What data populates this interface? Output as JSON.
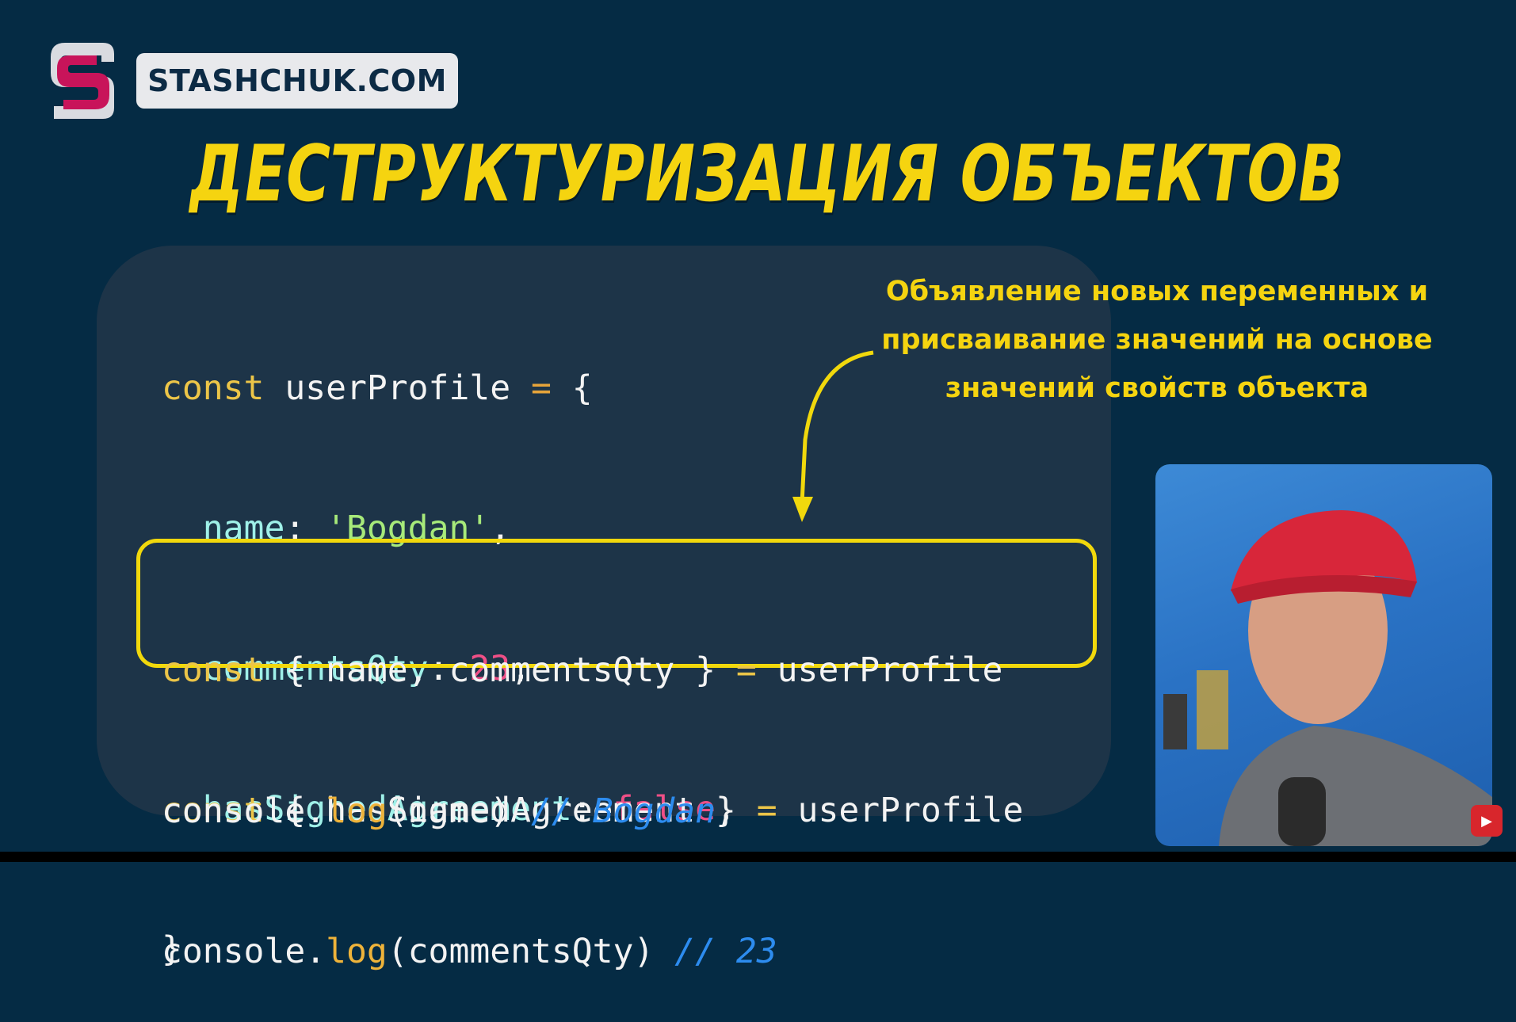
{
  "brand": {
    "logo_text": "STASHCHUK.COM"
  },
  "slide": {
    "title": "ДЕСТРУКТУРИЗАЦИЯ ОБЪЕКТОВ"
  },
  "code": {
    "object_block": {
      "l1_kw": "const",
      "l1_name": " userProfile ",
      "l1_op": "=",
      "l1_brace": " {",
      "l2_prop": "  name",
      "l2_colon": ": ",
      "l2_val": "'Bogdan'",
      "l2_comma": ",",
      "l3_prop": "  commentsQty",
      "l3_colon": ": ",
      "l3_val": "23",
      "l3_comma": ",",
      "l4_prop": "  hasSignedAgreement",
      "l4_colon": ": ",
      "l4_val": "false",
      "l4_comma": ",",
      "l5_brace": "}"
    },
    "destructure_block": {
      "l1_kw": "const",
      "l1_mid": " { name, commentsQty } ",
      "l1_op": "=",
      "l1_rhs": " userProfile",
      "l2_kw": "const",
      "l2_mid": " { hasSignedAgreement } ",
      "l2_op": "=",
      "l2_rhs": " userProfile"
    },
    "log_block": {
      "l1_obj": "console.",
      "l1_fn": "log",
      "l1_args": "(name) ",
      "l1_comment": "// Bogdan",
      "l2_obj": "console.",
      "l2_fn": "log",
      "l2_args": "(commentsQty) ",
      "l2_comment": "// 23"
    }
  },
  "annotation": {
    "line1": "Объявление новых переменных и",
    "line2": "присваивание значений на основе",
    "line3": "значений свойств объекта"
  },
  "colors": {
    "background": "#052b44",
    "title": "#f5d410",
    "highlight_border": "#f1d80c",
    "code_card": "#1d3448"
  }
}
